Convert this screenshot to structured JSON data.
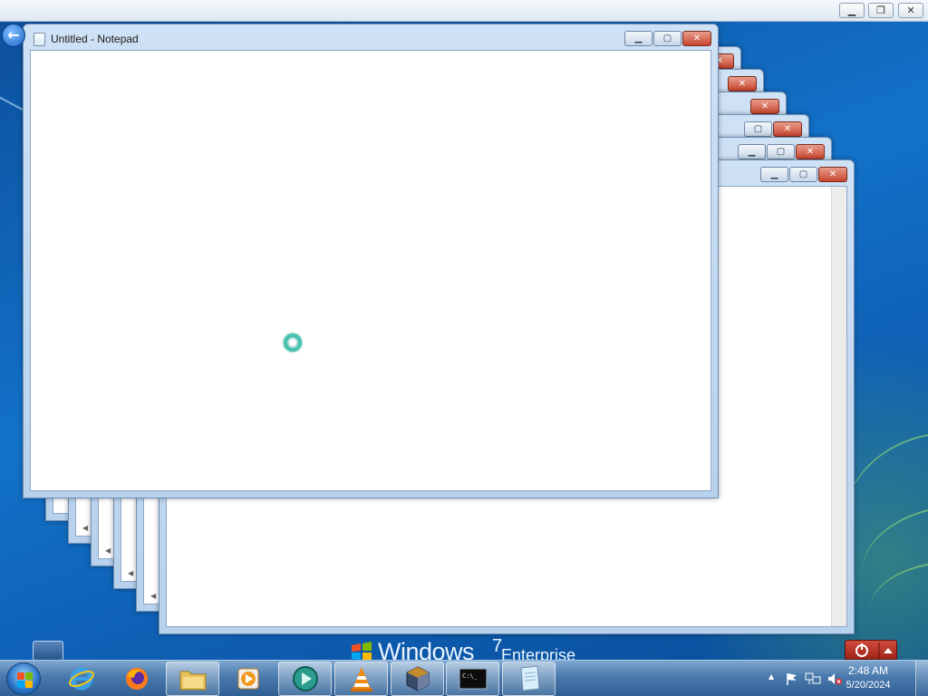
{
  "notepad": {
    "title": "Untitled - Notepad",
    "minimize_glyph": "▁",
    "maximize_glyph": "▢",
    "close_glyph": "✕"
  },
  "host_bar": {
    "minimize_glyph": "▁",
    "restore_glyph": "❐",
    "close_glyph": "✕"
  },
  "branding": {
    "product": "Windows",
    "version": "7",
    "edition": "Enterprise"
  },
  "taskbar": {
    "items": [
      {
        "name": "internet-explorer",
        "icon": "ie-icon"
      },
      {
        "name": "firefox",
        "icon": "firefox-icon"
      },
      {
        "name": "windows-explorer",
        "icon": "folder-icon"
      },
      {
        "name": "media-player",
        "icon": "play-icon"
      },
      {
        "name": "media-center",
        "icon": "play-circle-icon"
      },
      {
        "name": "vlc",
        "icon": "vlc-cone-icon"
      },
      {
        "name": "virtualbox",
        "icon": "cube-icon"
      },
      {
        "name": "command-prompt",
        "icon": "cmd-icon",
        "label": "C:\\_"
      },
      {
        "name": "notepad",
        "icon": "notepad-icon"
      }
    ]
  },
  "tray": {
    "time": "2:48 AM",
    "date": "5/20/2024",
    "overflow_glyph": "▲"
  },
  "colors": {
    "taskbar": "#3f6fa3",
    "close_button": "#c8452e",
    "busy_cursor": "#49c4b0",
    "desktop": "#1272c9"
  }
}
